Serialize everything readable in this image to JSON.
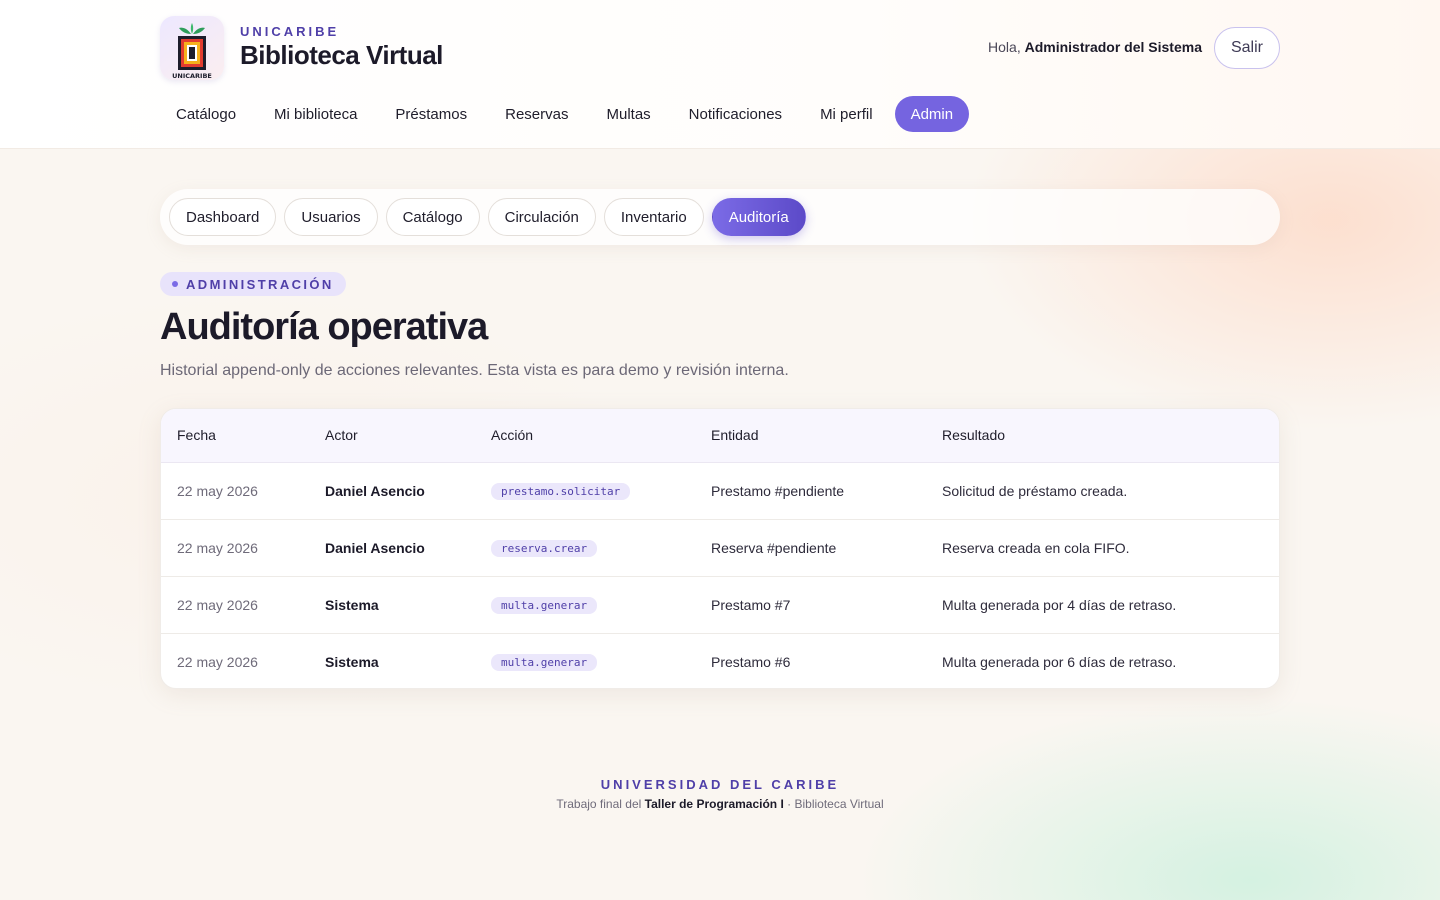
{
  "header": {
    "brand_kicker": "UNICARIBE",
    "brand_title": "Biblioteca Virtual",
    "logo_label": "UNICARIBE",
    "greeting_prefix": "Hola,",
    "user_name": "Administrador del Sistema",
    "logout_label": "Salir",
    "nav": [
      {
        "label": "Catálogo"
      },
      {
        "label": "Mi biblioteca"
      },
      {
        "label": "Préstamos"
      },
      {
        "label": "Reservas"
      },
      {
        "label": "Multas"
      },
      {
        "label": "Notificaciones"
      },
      {
        "label": "Mi perfil"
      },
      {
        "label": "Admin",
        "active": true
      }
    ]
  },
  "subnav": {
    "tabs": [
      {
        "label": "Dashboard"
      },
      {
        "label": "Usuarios"
      },
      {
        "label": "Catálogo"
      },
      {
        "label": "Circulación"
      },
      {
        "label": "Inventario"
      },
      {
        "label": "Auditoría",
        "active": true
      }
    ]
  },
  "page": {
    "kicker": "ADMINISTRACIÓN",
    "title": "Auditoría operativa",
    "subtitle": "Historial append-only de acciones relevantes. Esta vista es para demo y revisión interna."
  },
  "table": {
    "columns": [
      "Fecha",
      "Actor",
      "Acción",
      "Entidad",
      "Resultado"
    ],
    "rows": [
      {
        "fecha": "22 may 2026",
        "actor": "Daniel Asencio",
        "accion": "prestamo.solicitar",
        "entidad": "Prestamo #pendiente",
        "resultado": "Solicitud de préstamo creada."
      },
      {
        "fecha": "22 may 2026",
        "actor": "Daniel Asencio",
        "accion": "reserva.crear",
        "entidad": "Reserva #pendiente",
        "resultado": "Reserva creada en cola FIFO."
      },
      {
        "fecha": "22 may 2026",
        "actor": "Sistema",
        "accion": "multa.generar",
        "entidad": "Prestamo #7",
        "resultado": "Multa generada por 4 días de retraso."
      },
      {
        "fecha": "22 may 2026",
        "actor": "Sistema",
        "accion": "multa.generar",
        "entidad": "Prestamo #6",
        "resultado": "Multa generada por 6 días de retraso."
      }
    ]
  },
  "footer": {
    "kicker": "UNIVERSIDAD DEL CARIBE",
    "text_prefix": "Trabajo final del",
    "text_bold": "Taller de Programación I",
    "text_suffix": "· Biblioteca Virtual"
  },
  "colors": {
    "accent": "#7564e0",
    "accent_dark": "#4f3fa8",
    "text": "#1c1a29"
  },
  "icons": {
    "logo": "unicaribe-library-logo"
  }
}
